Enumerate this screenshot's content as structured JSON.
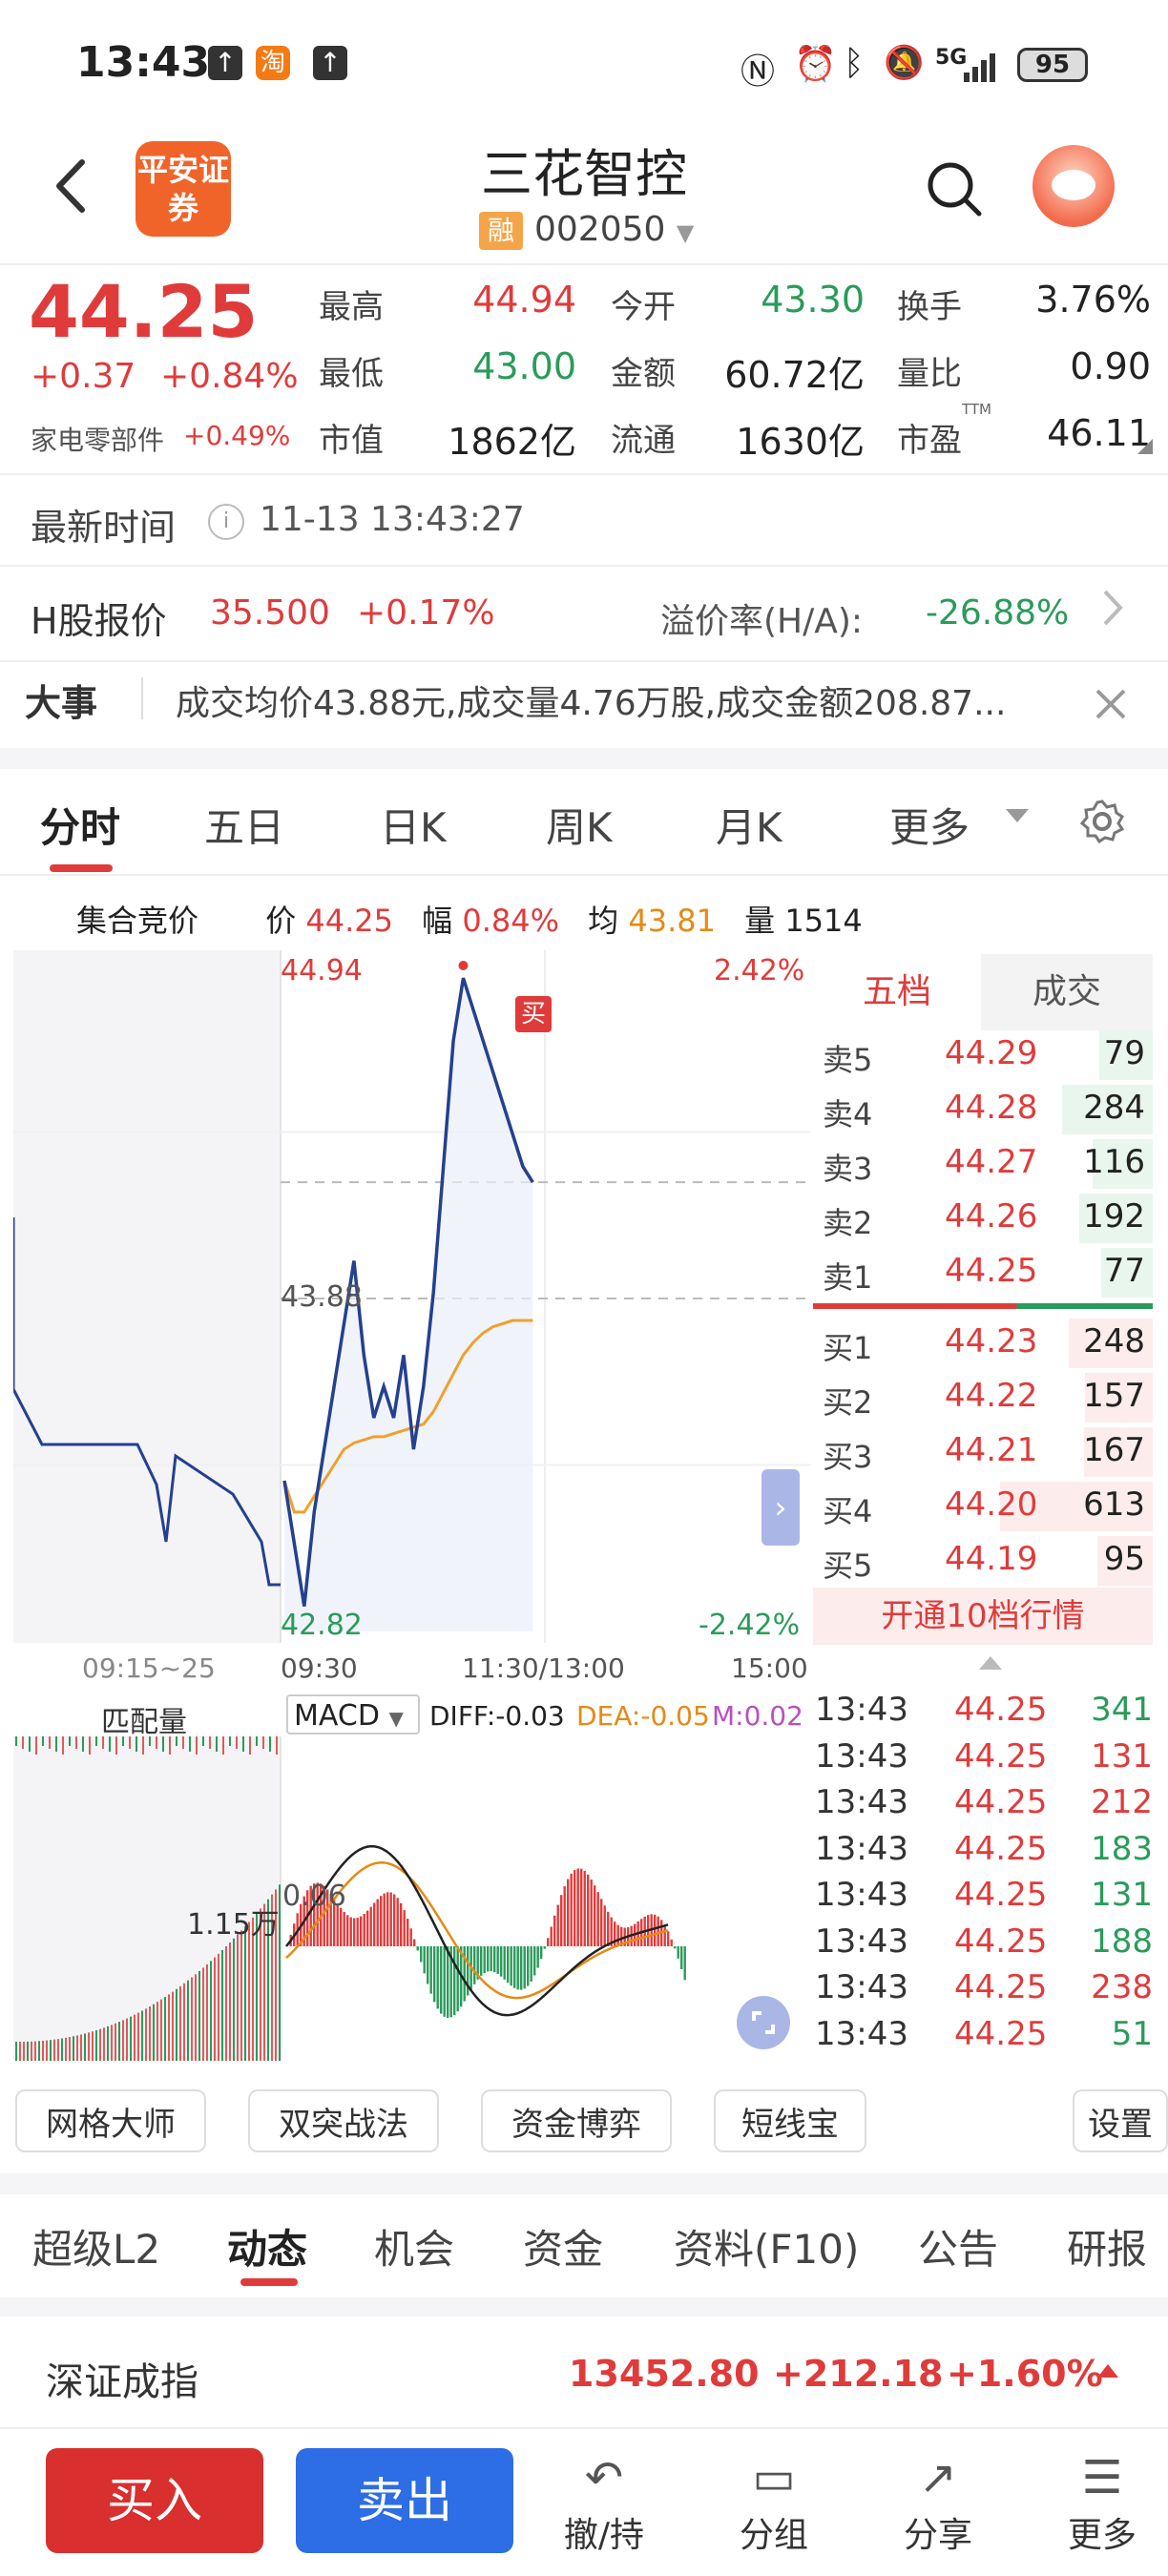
{
  "status_bar": {
    "time": "13:43",
    "battery": "95",
    "network": "5G"
  },
  "header": {
    "back_label": "<",
    "broker_logo": "平安证券",
    "stock_name": "三花智控",
    "tag": "融",
    "code": "002050"
  },
  "quote": {
    "price": "44.25",
    "change": "+0.37",
    "change_pct": "+0.84%",
    "sector": "家电零部件",
    "sector_pct": "+0.49%",
    "fields": [
      {
        "label": "最高",
        "value": "44.94",
        "color": "red"
      },
      {
        "label": "今开",
        "value": "43.30",
        "color": "green"
      },
      {
        "label": "换手",
        "value": "3.76%",
        "color": "black"
      },
      {
        "label": "最低",
        "value": "43.00",
        "color": "green"
      },
      {
        "label": "金额",
        "value": "60.72亿",
        "color": "black"
      },
      {
        "label": "量比",
        "value": "0.90",
        "color": "black"
      },
      {
        "label": "市值",
        "value": "1862亿",
        "color": "black"
      },
      {
        "label": "流通",
        "value": "1630亿",
        "color": "black"
      },
      {
        "label": "市盈",
        "value": "46.11",
        "color": "black"
      }
    ],
    "ttm_label": "TTM"
  },
  "latest_time": {
    "label": "最新时间",
    "value": "11-13 13:43:27"
  },
  "h_share": {
    "label": "H股报价",
    "price": "35.500",
    "pct": "+0.17%",
    "premium_label": "溢价率(H/A):",
    "premium_value": "-26.88%"
  },
  "news": {
    "label": "大事",
    "text": "成交均价43.88元,成交量4.76万股,成交金额208.87..."
  },
  "chart_tabs": [
    "分时",
    "五日",
    "日K",
    "周K",
    "月K",
    "更多"
  ],
  "chart_info": {
    "auction_label": "集合竞价",
    "price_label": "价",
    "price": "44.25",
    "range_label": "幅",
    "range": "0.84%",
    "avg_label": "均",
    "avg": "43.81",
    "vol_label": "量",
    "vol": "1514"
  },
  "chart_axis": {
    "high": "44.94",
    "high_pct": "2.42%",
    "mid": "43.88",
    "low": "42.82",
    "low_pct": "-2.42%",
    "buy_marker": "买",
    "times": [
      "09:15~25",
      "09:30",
      "11:30/13:00",
      "15:00"
    ]
  },
  "chart_data": {
    "type": "line",
    "title": "",
    "ylim": [
      42.82,
      44.94
    ],
    "series": [
      {
        "name": "价",
        "values": [
          43.3,
          43.1,
          42.9,
          43.2,
          43.4,
          43.6,
          43.8,
          44.0,
          43.7,
          43.5,
          43.6,
          43.5,
          43.7,
          43.4,
          43.6,
          43.9,
          44.3,
          44.7,
          44.9,
          44.8,
          44.7,
          44.6,
          44.5,
          44.4,
          44.3,
          44.25
        ]
      },
      {
        "name": "均",
        "values": [
          43.3,
          43.2,
          43.2,
          43.25,
          43.3,
          43.35,
          43.4,
          43.42,
          43.43,
          43.44,
          43.44,
          43.45,
          43.46,
          43.47,
          43.48,
          43.52,
          43.58,
          43.64,
          43.7,
          43.74,
          43.77,
          43.79,
          43.8,
          43.81,
          43.81,
          43.81
        ]
      }
    ]
  },
  "macd": {
    "match_label": "匹配量",
    "name": "MACD",
    "diff": "DIFF:-0.03",
    "dea": "DEA:-0.05",
    "m": "M:0.02",
    "vol_label": "1.15万",
    "zero_label": "0.06"
  },
  "order_book": {
    "tabs": [
      "五档",
      "成交"
    ],
    "sells": [
      {
        "label": "卖5",
        "price": "44.29",
        "qty": "79",
        "fill": 0.13
      },
      {
        "label": "卖4",
        "price": "44.28",
        "qty": "284",
        "fill": 0.46
      },
      {
        "label": "卖3",
        "price": "44.27",
        "qty": "116",
        "fill": 0.19
      },
      {
        "label": "卖2",
        "price": "44.26",
        "qty": "192",
        "fill": 0.31
      },
      {
        "label": "卖1",
        "price": "44.25",
        "qty": "77",
        "fill": 0.12
      }
    ],
    "buys": [
      {
        "label": "买1",
        "price": "44.23",
        "qty": "248",
        "fill": 0.4
      },
      {
        "label": "买2",
        "price": "44.22",
        "qty": "157",
        "fill": 0.26
      },
      {
        "label": "买3",
        "price": "44.21",
        "qty": "167",
        "fill": 0.27
      },
      {
        "label": "买4",
        "price": "44.20",
        "qty": "613",
        "fill": 1.0
      },
      {
        "label": "买5",
        "price": "44.19",
        "qty": "95",
        "fill": 0.15
      }
    ],
    "open_l2": "开通10档行情"
  },
  "trades": [
    {
      "time": "13:43",
      "price": "44.25",
      "qty": "341",
      "dir": "green"
    },
    {
      "time": "13:43",
      "price": "44.25",
      "qty": "131",
      "dir": "red"
    },
    {
      "time": "13:43",
      "price": "44.25",
      "qty": "212",
      "dir": "red"
    },
    {
      "time": "13:43",
      "price": "44.25",
      "qty": "183",
      "dir": "green"
    },
    {
      "time": "13:43",
      "price": "44.25",
      "qty": "131",
      "dir": "green"
    },
    {
      "time": "13:43",
      "price": "44.25",
      "qty": "188",
      "dir": "green"
    },
    {
      "time": "13:43",
      "price": "44.25",
      "qty": "238",
      "dir": "red"
    },
    {
      "time": "13:43",
      "price": "44.25",
      "qty": "51",
      "dir": "green"
    }
  ],
  "tools": [
    "网格大师",
    "双突战法",
    "资金博弈",
    "短线宝",
    "设置"
  ],
  "info_tabs": [
    "超级L2",
    "动态",
    "机会",
    "资金",
    "资料(F10)",
    "公告",
    "研报"
  ],
  "index": {
    "name": "深证成指",
    "value": "13452.80",
    "change": "+212.18",
    "pct": "+1.60%"
  },
  "bottom_bar": {
    "buy": "买入",
    "sell": "卖出",
    "items": [
      "撤/持",
      "分组",
      "分享",
      "更多"
    ]
  }
}
